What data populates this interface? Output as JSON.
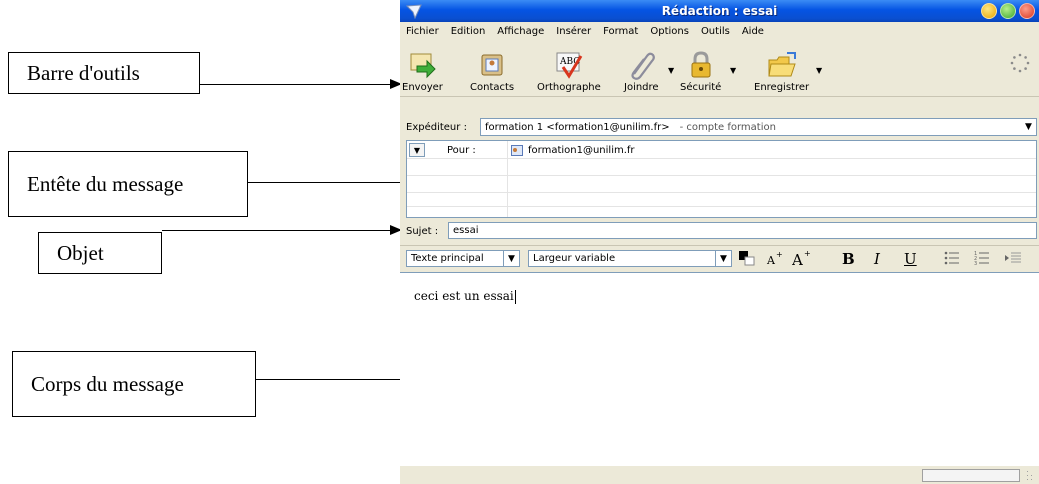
{
  "annotations": [
    {
      "text": "Barre d'outils"
    },
    {
      "text": "Entête du message"
    },
    {
      "text": "Objet"
    },
    {
      "text": "Corps du message"
    }
  ],
  "window": {
    "title": "Rédaction : essai",
    "menu": [
      "Fichier",
      "Edition",
      "Affichage",
      "Insérer",
      "Format",
      "Options",
      "Outils",
      "Aide"
    ],
    "toolbar": [
      "Envoyer",
      "Contacts",
      "Orthographe",
      "Joindre",
      "Sécurité",
      "Enregistrer"
    ],
    "sender": {
      "label": "Expéditeur :",
      "value": "formation 1 <formation1@unilim.fr>",
      "account": "- compte formation"
    },
    "recipients": [
      {
        "type": "Pour :",
        "address": "formation1@unilim.fr"
      }
    ],
    "subject": {
      "label": "Sujet :",
      "value": "essai"
    },
    "format": {
      "paragraph_style": "Texte principal",
      "font": "Largeur variable",
      "text_color": "#000000",
      "bold": "B",
      "italic": "I",
      "underline": "U"
    },
    "body": "ceci est un essai"
  },
  "colors": {
    "titlebar": "#0554e3",
    "chrome": "#ece9d8",
    "field_border": "#7f9db9"
  }
}
